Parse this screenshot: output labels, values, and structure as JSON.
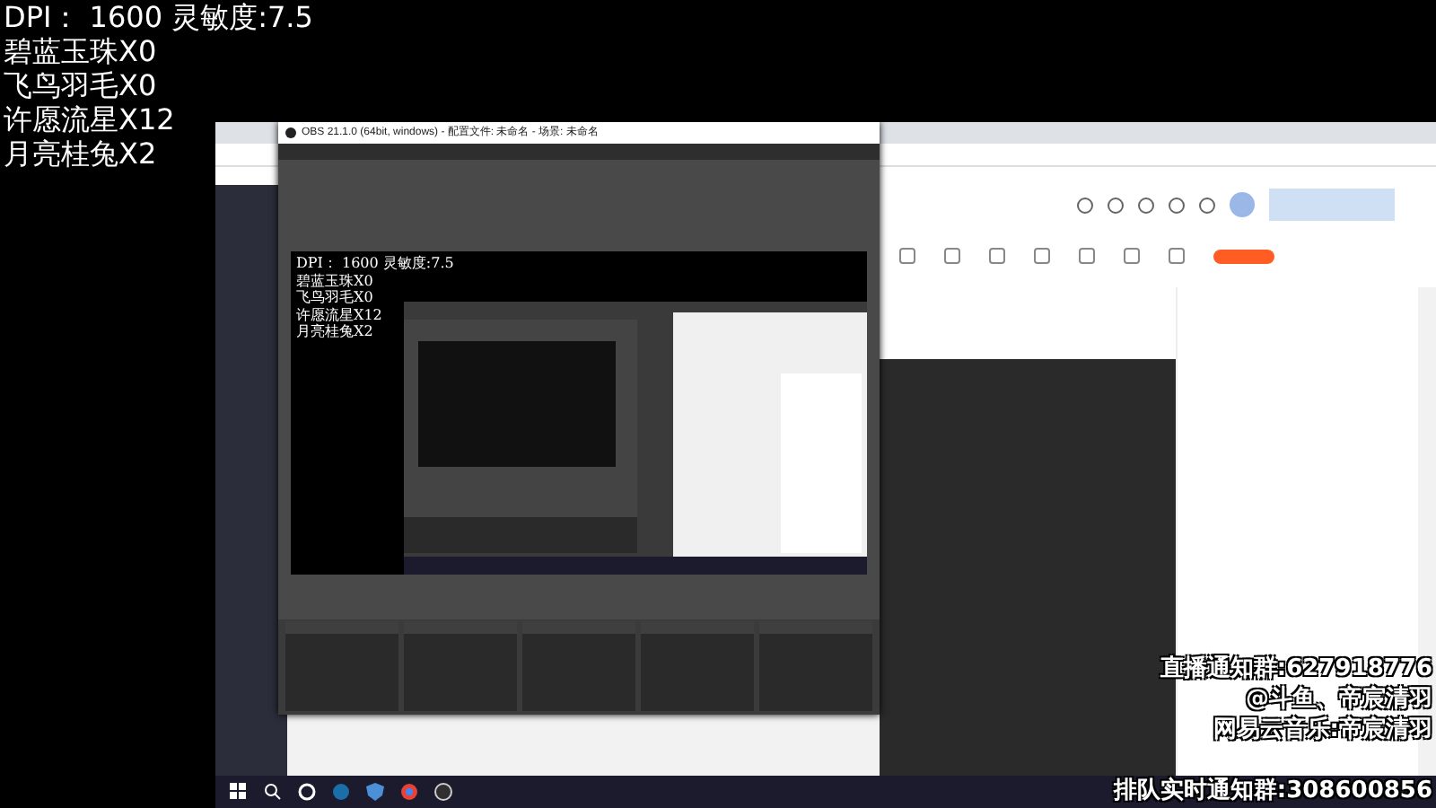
{
  "overlay_stats": [
    "DPI： 1600 灵敏度:7.5",
    "碧蓝玉珠X0",
    "飞鸟羽毛X0",
    "许愿流星X12",
    "月亮桂兔X2"
  ],
  "obs_window": {
    "title": "OBS 21.1.0 (64bit, windows) - 配置文件: 未命名 - 场景: 未命名",
    "preview_overlay_stats": [
      "DPI： 1600 灵敏度:7.5",
      "碧蓝玉珠X0",
      "飞鸟羽毛X0",
      "许愿流星X12",
      "月亮桂兔X2"
    ]
  },
  "stream_notice": [
    "直播通知群:627918776",
    "@斗鱼、帝宸清羽",
    "网易云音乐:帝宸清羽",
    "排队实时通知群:308600856"
  ]
}
